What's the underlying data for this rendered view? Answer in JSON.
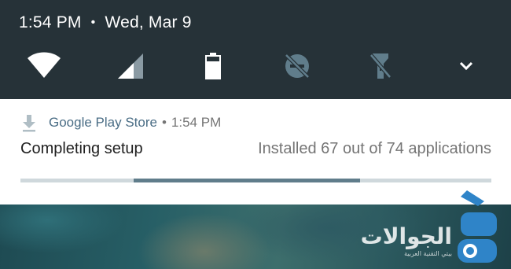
{
  "status_bar": {
    "time": "1:54 PM",
    "separator": "•",
    "date": "Wed, Mar 9"
  },
  "quick_settings": [
    {
      "icon": "wifi-icon",
      "state": "on"
    },
    {
      "icon": "cellular-signal-icon",
      "state": "on"
    },
    {
      "icon": "battery-icon",
      "state": "on"
    },
    {
      "icon": "do-not-disturb-off-icon",
      "state": "off"
    },
    {
      "icon": "flashlight-off-icon",
      "state": "off"
    },
    {
      "icon": "expand-chevron-icon",
      "state": "collapsed"
    }
  ],
  "notification": {
    "app_name": "Google Play Store",
    "separator": "•",
    "time": "1:54 PM",
    "title": "Completing setup",
    "text": "Installed 67 out of 74 applications",
    "progress_fraction": 0.48
  },
  "watermark": {
    "text": "الجوالات",
    "subtext": "بيتي التقنية العربية"
  },
  "colors": {
    "shade": "#263238",
    "icon_white": "#ffffff",
    "icon_dim": "#607d8b",
    "progress_track": "#cfd8dc",
    "progress_fill": "#607d8b",
    "app_name": "#4a6d85",
    "watermark_accent": "#2f84c8"
  }
}
